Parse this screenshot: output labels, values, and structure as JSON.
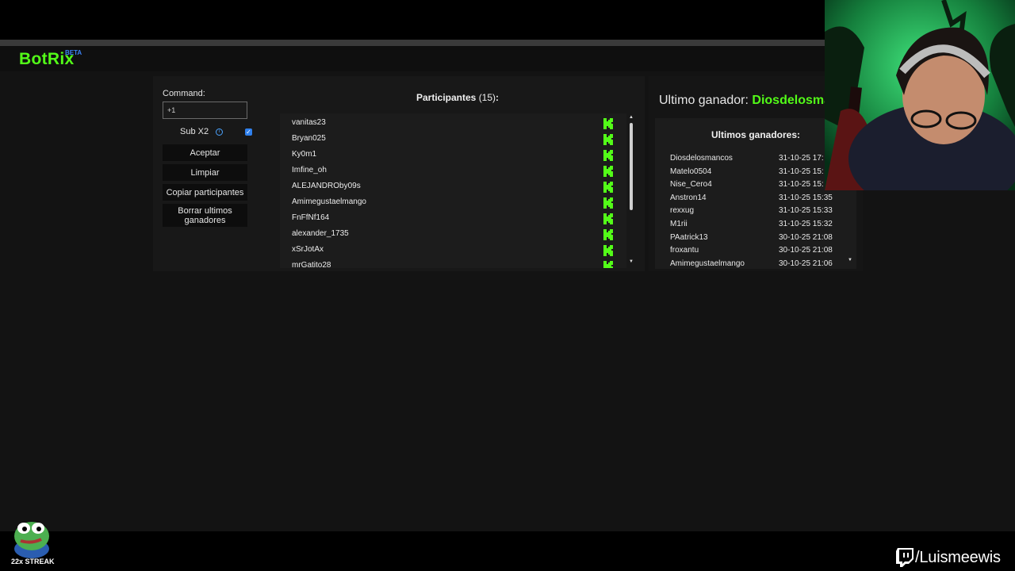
{
  "app": {
    "logo": "BotRix",
    "beta": "BETA"
  },
  "controls": {
    "command_label": "Command:",
    "command_value": "+1",
    "sub_label": "Sub X2",
    "sub_checked": true,
    "accept_label": "Aceptar",
    "clear_label": "Limpiar",
    "copy_label": "Copiar participantes",
    "delete_label": "Borrar ultimos ganadores"
  },
  "participants": {
    "title": "Participantes",
    "count": "(15)",
    "colon": ":",
    "items": [
      {
        "name": "vanitas23"
      },
      {
        "name": "Bryan025"
      },
      {
        "name": "Ky0m1"
      },
      {
        "name": "Imfine_oh"
      },
      {
        "name": "ALEJANDROby09s"
      },
      {
        "name": "Amimegustaelmango"
      },
      {
        "name": "FnFfNf164"
      },
      {
        "name": "alexander_1735"
      },
      {
        "name": "xSrJotAx"
      },
      {
        "name": "mrGatito28"
      }
    ]
  },
  "last_winner": {
    "label": "Ultimo ganador:",
    "name": "Diosdelosma"
  },
  "winners": {
    "title": "Ultimos ganadores:",
    "rows": [
      {
        "name": "Diosdelosmancos",
        "date": "31-10-25 17:"
      },
      {
        "name": "Matelo0504",
        "date": "31-10-25 15:"
      },
      {
        "name": "Nise_Cero4",
        "date": "31-10-25 15:"
      },
      {
        "name": "Anstron14",
        "date": "31-10-25 15:35"
      },
      {
        "name": "rexxug",
        "date": "31-10-25 15:33"
      },
      {
        "name": "M1rii",
        "date": "31-10-25 15:32"
      },
      {
        "name": "PAatrick13",
        "date": "30-10-25 21:08"
      },
      {
        "name": "froxantu",
        "date": "30-10-25 21:08"
      },
      {
        "name": "Amimegustaelmango",
        "date": "30-10-25 21:06"
      }
    ]
  },
  "stream": {
    "streak_label": "22x STREAK",
    "channel": "/Luismeewis"
  },
  "colors": {
    "accent_green": "#53fc18",
    "beta_blue": "#3b82f6",
    "checkbox_blue": "#2f80ed"
  },
  "icons": [
    "kick-logo-icon",
    "info-icon",
    "checkbox-checked-icon",
    "scroll-up-icon",
    "scroll-down-icon",
    "twitch-icon",
    "pepe-emote-icon"
  ]
}
